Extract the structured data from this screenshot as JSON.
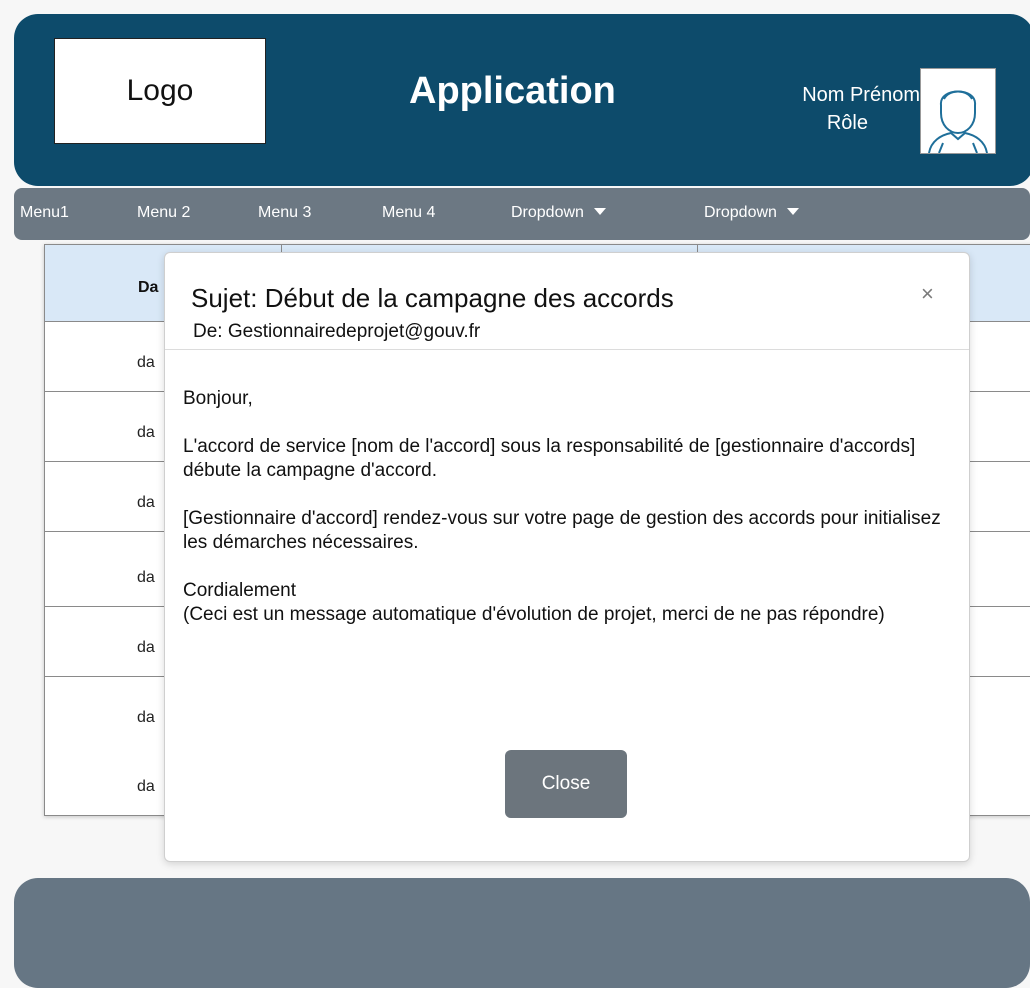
{
  "header": {
    "logo": "Logo",
    "title": "Application",
    "user_name": "Nom Prénom",
    "user_role": "Rôle",
    "colors": {
      "background": "#0d4b6b",
      "text": "#ffffff"
    }
  },
  "nav": {
    "items": [
      {
        "label": "Menu1"
      },
      {
        "label": "Menu 2"
      },
      {
        "label": "Menu 3"
      },
      {
        "label": "Menu 4"
      },
      {
        "label": "Dropdown"
      },
      {
        "label": "Dropdown"
      }
    ],
    "color": "#6c7883"
  },
  "table": {
    "header": "Da",
    "rows": [
      "da",
      "da",
      "da",
      "da",
      "da",
      "da",
      "da"
    ],
    "header_color": "#d9e8f7"
  },
  "modal": {
    "subject": "Sujet: Début de la campagne des accords",
    "from": "De: Gestionnairedeprojet@gouv.fr",
    "close_icon": "×",
    "body": {
      "greeting": "Bonjour,",
      "paragraph1": "L'accord de service [nom de l'accord] sous la responsabilité de [gestionnaire d'accords] débute la campagne d'accord.",
      "paragraph2": "[Gestionnaire d'accord] rendez-vous sur votre page de gestion des accords pour initialisez les démarches nécessaires.",
      "signoff": "Cordialement",
      "note": "(Ceci est un message automatique d'évolution de projet, merci de ne pas répondre)"
    },
    "close_button": "Close",
    "button_color": "#6c757d"
  },
  "footer": {
    "color": "#667684"
  }
}
